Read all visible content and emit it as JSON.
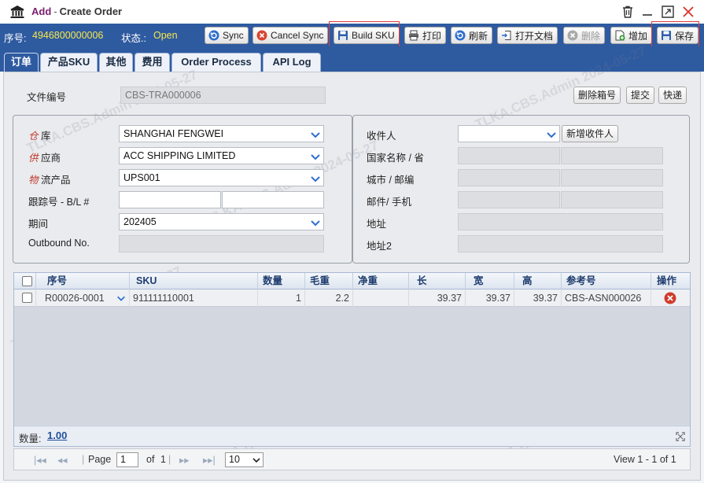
{
  "window": {
    "title_prefix": "Add",
    "title_separator": "-",
    "title": "Create Order"
  },
  "toolbar": {
    "order_no_label": "序号:",
    "order_no": "4946800000006",
    "status_label": "状态.:",
    "status": "Open",
    "buttons": {
      "sync": "Sync",
      "cancel_sync": "Cancel Sync",
      "build_sku": "Build SKU",
      "print": "打印",
      "refresh": "刷新",
      "open_doc": "打开文档",
      "delete": "删除",
      "add": "增加",
      "save": "保存"
    }
  },
  "tabs": [
    "订单",
    "产品SKU",
    "其他",
    "费用",
    "Order Process",
    "API Log"
  ],
  "form": {
    "doc_no_label": "文件编号",
    "doc_no": "CBS-TRA000006",
    "delete_box_button": "删除箱号",
    "submit_button": "提交",
    "express_button": "快递",
    "warehouse_label_mark": "仓",
    "warehouse_label": "库",
    "warehouse": "SHANGHAI FENGWEI",
    "supplier_label_mark": "供",
    "supplier_label": "应商",
    "supplier": "ACC SHIPPING LIMITED",
    "logistics_label_mark": "物",
    "logistics_label": "流产品",
    "logistics": "UPS001",
    "tracking_label": "跟踪号 - B/L #",
    "tracking_1": "",
    "tracking_2": "",
    "period_label": "期间",
    "period": "202405",
    "outbound_label": "Outbound No.",
    "outbound": "",
    "recipient_label": "收件人",
    "recipient": "",
    "new_recipient_button": "新增收件人",
    "country_label": "国家名称 / 省",
    "city_label": "城市 / 邮编",
    "email_label": "邮件/ 手机",
    "address_label": "地址",
    "address2_label": "地址2"
  },
  "grid": {
    "columns": [
      "序号",
      "SKU",
      "数量",
      "毛重",
      "净重",
      "长",
      "宽",
      "高",
      "参考号",
      "操作"
    ],
    "rows": [
      {
        "seq": "R00026-0001",
        "sku": "911111110001",
        "qty": "1",
        "gross": "2.2",
        "net": "",
        "length": "39.37",
        "width": "39.37",
        "height": "39.37",
        "ref": "CBS-ASN000026"
      }
    ],
    "qty_total_label": "数量:",
    "qty_total": "1.00"
  },
  "pager": {
    "page_label": "Page",
    "page": "1",
    "of_label": "of",
    "total_pages": "1",
    "page_size": "10",
    "view_text": "View 1 - 1 of 1"
  },
  "watermark": "TLKA.CBS.Admin 2024-05-27",
  "colors": {
    "toolbar_bg": "#2e5aa0",
    "order_no": "#f7e84a",
    "title_accent": "#7a1f6e",
    "highlight": "#e03c3c",
    "grid_header_text": "#1f3d6e"
  }
}
